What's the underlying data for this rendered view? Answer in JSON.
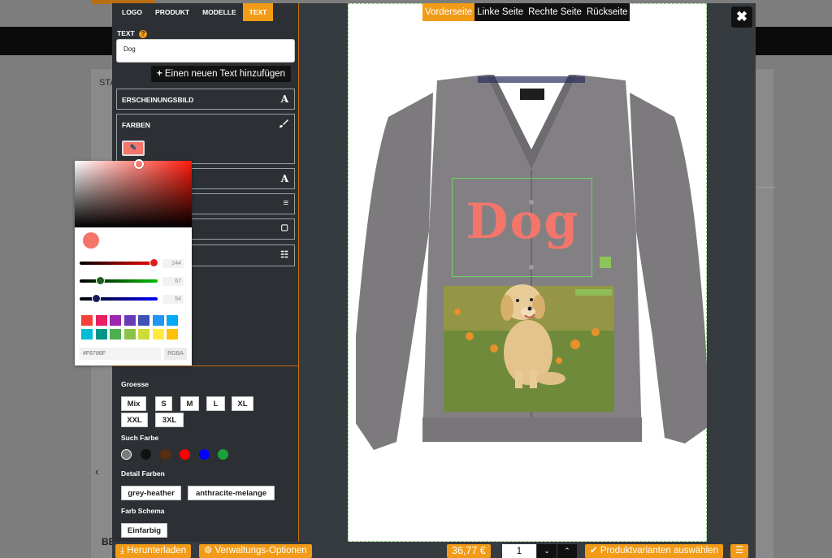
{
  "tabs": [
    "LOGO",
    "PRODUKT",
    "MODELLE",
    "TEXT"
  ],
  "active_tab": 3,
  "text_section": {
    "label": "TEXT",
    "help": "?",
    "input_value": "Dog",
    "add_button": "Einen neuen Text hinzufügen",
    "add_icon": "+"
  },
  "accordion": {
    "appearance": "ERSCHEINUNGSBILD",
    "colors": "FARBEN"
  },
  "color_picker": {
    "r": 244,
    "g": 67,
    "b": 54,
    "r_label": "244",
    "g_label": "67",
    "b_label": "54",
    "hex": "#F6786F",
    "mode_button": "RGBA",
    "current_color": "#f4756a",
    "swatches": [
      "#f44336",
      "#e91e63",
      "#9c27b0",
      "#673ab7",
      "#3f51b5",
      "#2196f3",
      "#03a9f4",
      "#00bcd4",
      "#009688",
      "#4caf50",
      "#8bc34a",
      "#cddc39",
      "#ffeb3b",
      "#ffc107"
    ]
  },
  "filters": {
    "size_label": "Groesse",
    "sizes": [
      "Mix",
      "S",
      "M",
      "L",
      "XL",
      "XXL",
      "3XL"
    ],
    "color_search_label": "Such Farbe",
    "color_dots": [
      "#7a7a7a",
      "#111111",
      "#5a2d0c",
      "#ff0000",
      "#0000ff",
      "#1aa33a"
    ],
    "detail_colors_label": "Detail Farben",
    "detail_colors": [
      "grey-heather",
      "anthracite-melange"
    ],
    "scheme_label": "Farb Schema",
    "scheme": "Einfarbig"
  },
  "views": [
    "Vorderseite",
    "Linke Seite",
    "Rechte Seite",
    "Rückseite"
  ],
  "active_view": 0,
  "design_text": "Dog",
  "close": "✖",
  "bottom": {
    "download": "Herunterladen",
    "admin": "Verwaltungs-Optionen",
    "price": "36,77 €",
    "quantity": "1",
    "variants": "Produktvarianten auswählen",
    "menu": "☰"
  },
  "background": {
    "sta": "STA",
    "be": "BE",
    "chevron": "‹"
  }
}
